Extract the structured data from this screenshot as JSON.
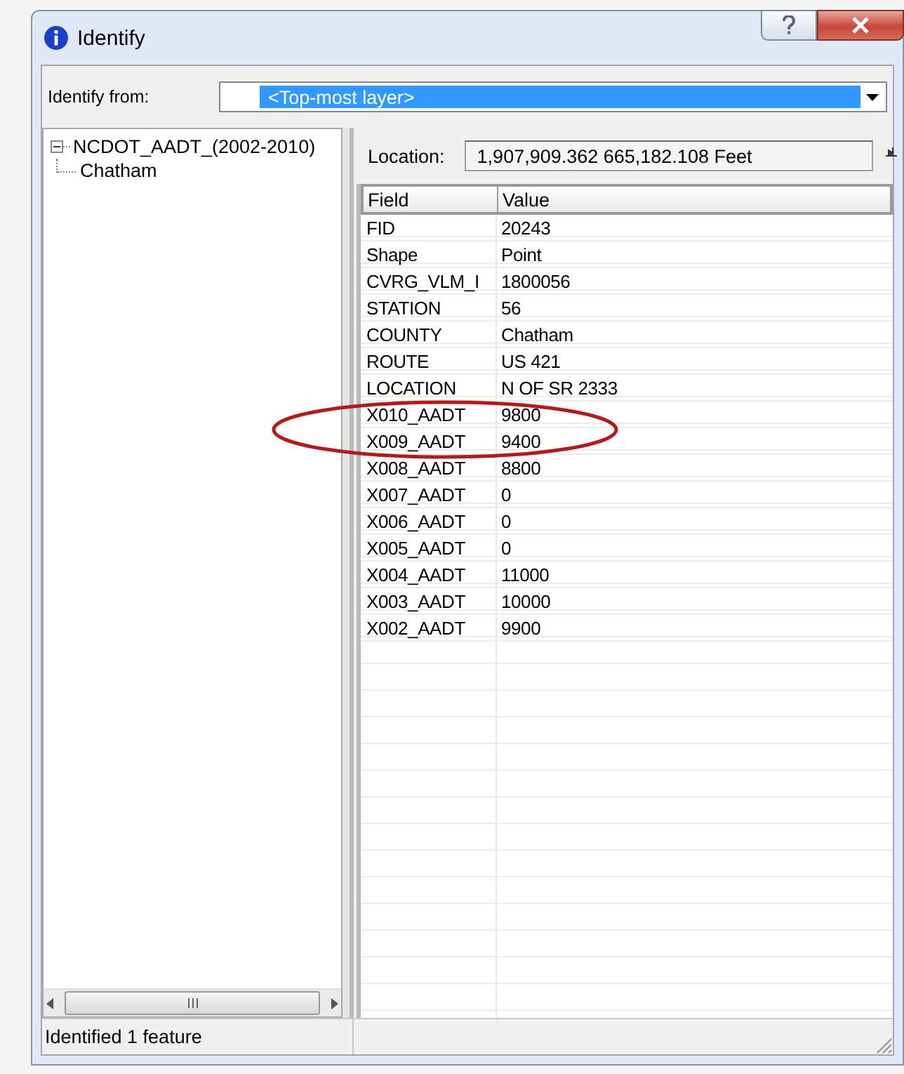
{
  "window": {
    "title": "Identify"
  },
  "identify_from": {
    "label": "Identify from:",
    "value": "<Top-most layer>"
  },
  "tree": [
    {
      "label": "NCDOT_AADT_(2002-2010)",
      "expanded": true,
      "children": [
        {
          "label": "Chatham"
        }
      ]
    }
  ],
  "location": {
    "label": "Location:",
    "value": "1,907,909.362  665,182.108 Feet"
  },
  "table": {
    "columns": [
      "Field",
      "Value"
    ],
    "rows": [
      [
        "FID",
        "20243"
      ],
      [
        "Shape",
        "Point"
      ],
      [
        "CVRG_VLM_I",
        "1800056"
      ],
      [
        "STATION",
        "56"
      ],
      [
        "COUNTY",
        "Chatham"
      ],
      [
        "ROUTE",
        "US 421"
      ],
      [
        "LOCATION",
        "N OF SR 2333"
      ],
      [
        "X010_AADT",
        "9800"
      ],
      [
        "X009_AADT",
        "9400"
      ],
      [
        "X008_AADT",
        "8800"
      ],
      [
        "X007_AADT",
        "0"
      ],
      [
        "X006_AADT",
        "0"
      ],
      [
        "X005_AADT",
        "0"
      ],
      [
        "X004_AADT",
        "11000"
      ],
      [
        "X003_AADT",
        "10000"
      ],
      [
        "X002_AADT",
        "9900"
      ]
    ]
  },
  "status_bar": {
    "text": "Identified 1 feature"
  }
}
